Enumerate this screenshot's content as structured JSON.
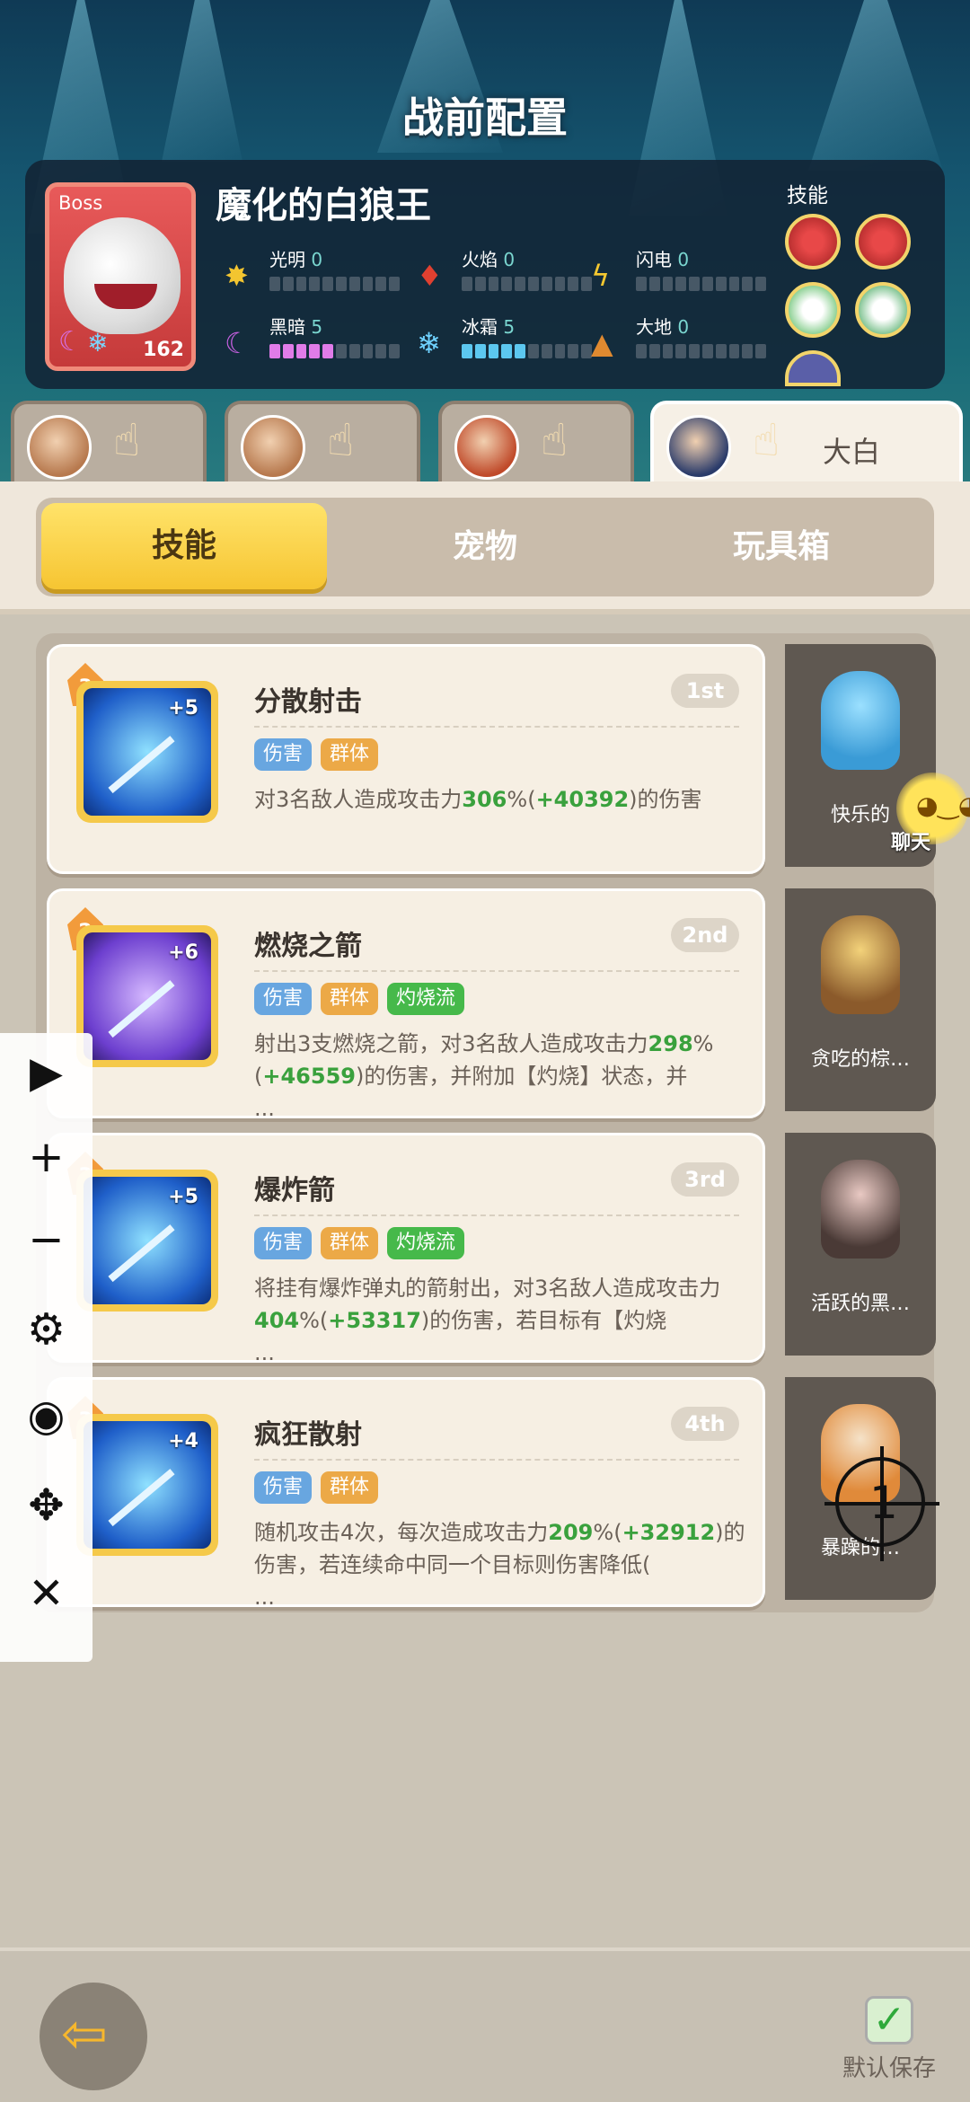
{
  "header": {
    "title": "战前配置"
  },
  "boss": {
    "tag": "Boss",
    "level": "162",
    "name": "魔化的白狼王",
    "elements": [
      {
        "name": "光明",
        "value": "0",
        "icon": "sun-icon",
        "fill": 0
      },
      {
        "name": "火焰",
        "value": "0",
        "icon": "fire-icon",
        "fill": 0
      },
      {
        "name": "闪电",
        "value": "0",
        "icon": "lightning-icon",
        "fill": 0
      },
      {
        "name": "黑暗",
        "value": "5",
        "icon": "moon-icon",
        "fill": 5
      },
      {
        "name": "冰霜",
        "value": "5",
        "icon": "snowflake-icon",
        "fill": 5
      },
      {
        "name": "大地",
        "value": "0",
        "icon": "earth-icon",
        "fill": 0
      }
    ],
    "skills_label": "技能"
  },
  "characters": [
    {
      "name": ""
    },
    {
      "name": ""
    },
    {
      "name": ""
    },
    {
      "name": "大白"
    }
  ],
  "tabs": [
    "技能",
    "宠物",
    "玩具箱"
  ],
  "skills": [
    {
      "level": "3",
      "plus": "+5",
      "name": "分散射击",
      "rank": "1st",
      "tags": [
        {
          "t": "伤害",
          "c": "b"
        },
        {
          "t": "群体",
          "c": "o"
        }
      ],
      "desc_a": "对3名敌人造成攻击力",
      "num1": "306",
      "desc_b": "%(",
      "num2": "+40392",
      "desc_c": ")的伤害",
      "more": ""
    },
    {
      "level": "2",
      "plus": "+6",
      "name": "燃烧之箭",
      "rank": "2nd",
      "tags": [
        {
          "t": "伤害",
          "c": "b"
        },
        {
          "t": "群体",
          "c": "o"
        },
        {
          "t": "灼烧流",
          "c": "g"
        }
      ],
      "desc_a": "射出3支燃烧之箭，对3名敌人造成攻击力",
      "num1": "298",
      "desc_b": "%(",
      "num2": "+46559",
      "desc_c": ")的伤害，并附加【灼烧】状态，并",
      "more": "..."
    },
    {
      "level": "3",
      "plus": "+5",
      "name": "爆炸箭",
      "rank": "3rd",
      "tags": [
        {
          "t": "伤害",
          "c": "b"
        },
        {
          "t": "群体",
          "c": "o"
        },
        {
          "t": "灼烧流",
          "c": "g"
        }
      ],
      "desc_a": "将挂有爆炸弹丸的箭射出，对3名敌人造成攻击力",
      "num1": "404",
      "desc_b": "%(",
      "num2": "+53317",
      "desc_c": ")的伤害，若目标有【灼烧",
      "more": "..."
    },
    {
      "level": "3",
      "plus": "+4",
      "name": "疯狂散射",
      "rank": "4th",
      "tags": [
        {
          "t": "伤害",
          "c": "b"
        },
        {
          "t": "群体",
          "c": "o"
        }
      ],
      "desc_a": "随机攻击4次，每次造成攻击力",
      "num1": "209",
      "desc_b": "%(",
      "num2": "+32912",
      "desc_c": ")的伤害，若连续命中同一个目标则伤害降低(",
      "more": "..."
    }
  ],
  "pets": [
    {
      "name": "快乐的"
    },
    {
      "name": "贪吃的棕…"
    },
    {
      "name": "活跃的黑…"
    },
    {
      "name": "暴躁的…"
    }
  ],
  "chat_label": "聊天",
  "overlay": {
    "target_number": "1"
  },
  "bottom": {
    "save_label": "默认保存"
  },
  "colors": {
    "accent_yellow": "#f6c532",
    "damage_blue": "#68a6e0",
    "group_orange": "#eca947",
    "burn_green": "#46b94a"
  }
}
